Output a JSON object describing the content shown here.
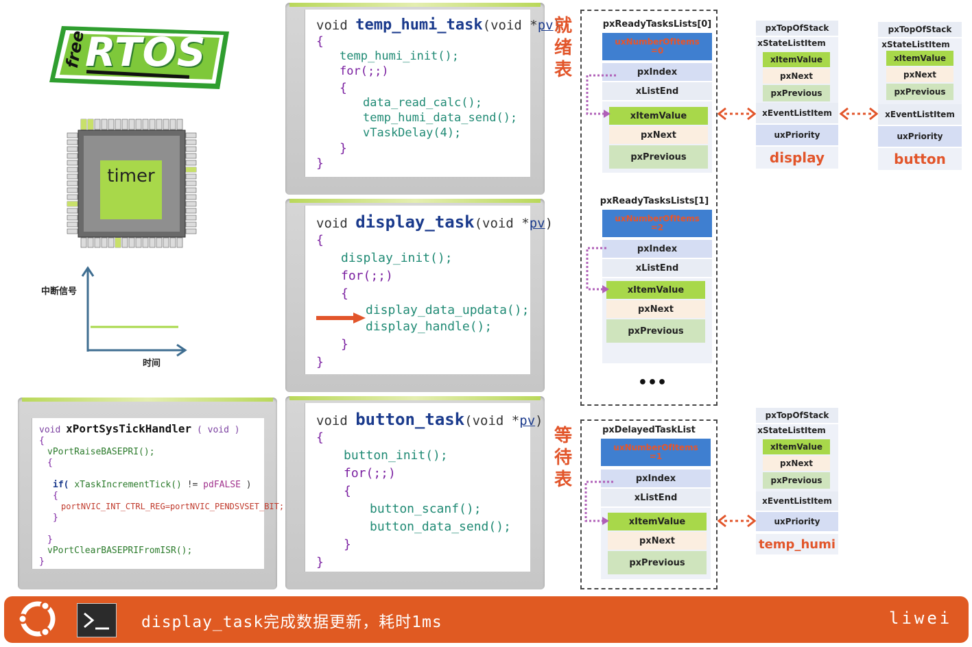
{
  "logo": {
    "free": "free",
    "rtos": "RTOS"
  },
  "chip": {
    "label": "timer"
  },
  "signal_axes": {
    "ylabel": "中断信号",
    "xlabel": "时间"
  },
  "panels": {
    "temp_humi": {
      "sig_void": "void",
      "sig_name": "temp_humi_task",
      "sig_paren": "(void *",
      "sig_param": "pv",
      "sig_close": ")",
      "open": "{",
      "init": "temp_humi_init();",
      "for": "for(;;)",
      "open2": "{",
      "l1": "data_read_calc();",
      "l2": "temp_humi_data_send();",
      "l3": "vTaskDelay(4);",
      "close2": "}",
      "close": "}"
    },
    "display": {
      "sig_void": "void",
      "sig_name": "display_task",
      "sig_paren": "(void *",
      "sig_param": "pv",
      "sig_close": ")",
      "open": "{",
      "init": "display_init();",
      "for": "for(;;)",
      "open2": "{",
      "l1": "display_data_updata();",
      "l2": "display_handle();",
      "close2": "}",
      "close": "}"
    },
    "button": {
      "sig_void": "void",
      "sig_name": "button_task",
      "sig_paren": "(void *",
      "sig_param": "pv",
      "sig_close": ")",
      "open": "{",
      "init": "button_init();",
      "for": "for(;;)",
      "open2": "{",
      "l1": "button_scanf();",
      "l2": "button_data_send();",
      "close2": "}",
      "close": "}"
    },
    "systick": {
      "sig_void": "void",
      "sig_name": "xPortSysTickHandler",
      "sig_arg": "( void )",
      "open": "{",
      "l1": "vPortRaiseBASEPRI();",
      "open2": "{",
      "if_kw": "if(",
      "if_call": "xTaskIncrementTick()",
      "if_op": "!=",
      "if_val": "pdFALSE",
      "if_close": ")",
      "open3": "{",
      "l2": "portNVIC_INT_CTRL_REG=portNVIC_PENDSVSET_BIT;",
      "close3": "}",
      "close2": "}",
      "l3": "vPortClearBASEPRIFromISR();",
      "close": "}"
    }
  },
  "side_labels": {
    "ready": [
      "就",
      "绪",
      "表"
    ],
    "wait": [
      "等",
      "待",
      "表"
    ]
  },
  "ready0": {
    "title": "pxReadyTasksLists[0]",
    "hdr1": "uxNumberOfItems",
    "hdr2": "=0",
    "index": "pxIndex",
    "end": "xListEnd",
    "item": "xItemValue",
    "next": "pxNext",
    "prev": "pxPrevious"
  },
  "ready1": {
    "title": "pxReadyTasksLists[1]",
    "hdr1": "uxNumberOfItems",
    "hdr2": "=2",
    "index": "pxIndex",
    "end": "xListEnd",
    "item": "xItemValue",
    "next": "pxNext",
    "prev": "pxPrevious",
    "more": "•••"
  },
  "delayed": {
    "title": "pxDelayedTaskList",
    "hdr1": "uxNumberOfItems",
    "hdr2": "=1",
    "index": "pxIndex",
    "end": "xListEnd",
    "item": "xItemValue",
    "next": "pxNext",
    "prev": "pxPrevious"
  },
  "tcbs": {
    "display": {
      "top": "pxTopOfStack",
      "state": "xStateListItem",
      "item": "xItemValue",
      "next": "pxNext",
      "prev": "pxPrevious",
      "event": "xEventListItem",
      "prio": "uxPriority",
      "name": "display"
    },
    "button": {
      "top": "pxTopOfStack",
      "state": "xStateListItem",
      "item": "xItemValue",
      "next": "pxNext",
      "prev": "pxPrevious",
      "event": "xEventListItem",
      "prio": "uxPriority",
      "name": "button"
    },
    "temp_humi": {
      "top": "pxTopOfStack",
      "state": "xStateListItem",
      "item": "xItemValue",
      "next": "pxNext",
      "prev": "pxPrevious",
      "event": "xEventListItem",
      "prio": "uxPriority",
      "name": "temp_humi"
    }
  },
  "status_bar": {
    "message": "display_task完成数据更新，耗时1ms",
    "author": "liwei"
  },
  "colors": {
    "accent": "#e2552a",
    "green": "#a8d84a",
    "blue": "#3f7fd0",
    "bar": "#e05a22"
  }
}
